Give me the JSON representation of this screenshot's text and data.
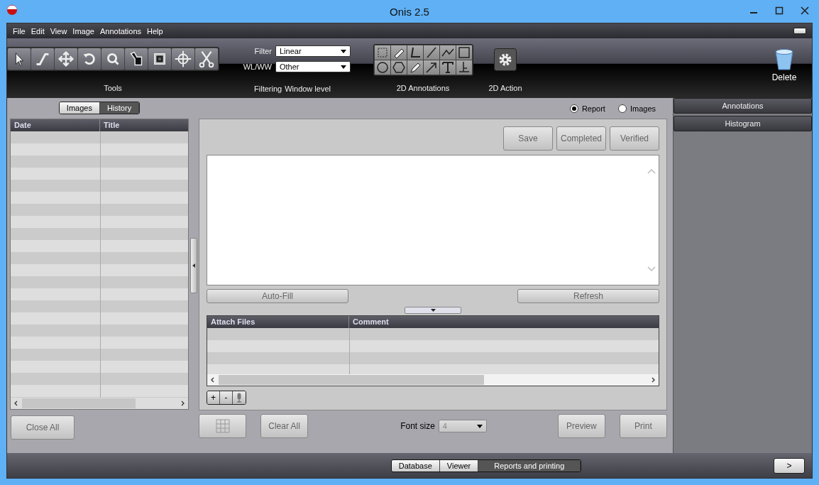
{
  "window": {
    "title": "Onis 2.5"
  },
  "menu": [
    "File",
    "Edit",
    "View",
    "Image",
    "Annotations",
    "Help"
  ],
  "toolbar": {
    "tools_label": "Tools",
    "filter": {
      "label": "Filter",
      "value": "Linear"
    },
    "wlww": {
      "label": "WL/WW",
      "value": "Other"
    },
    "filtering_label": "Filtering",
    "window_level_label": "Window level",
    "annotations_label": "2D Annotations",
    "action_label": "2D Action",
    "delete_label": "Delete"
  },
  "left_panel": {
    "tabs": [
      {
        "label": "Images",
        "selected": false
      },
      {
        "label": "History",
        "selected": true
      }
    ],
    "table": {
      "columns": [
        "Date",
        "Title"
      ]
    },
    "close_all": "Close All"
  },
  "report": {
    "view_options": [
      {
        "label": "Report",
        "selected": true
      },
      {
        "label": "Images",
        "selected": false
      }
    ],
    "actions": [
      "Save",
      "Completed",
      "Verified"
    ],
    "auto_fill": "Auto-Fill",
    "refresh": "Refresh",
    "attach_table": {
      "columns": [
        "Attach Files",
        "Comment"
      ]
    },
    "attach_buttons": [
      "+",
      "-"
    ],
    "clear_all": "Clear All",
    "font_size": {
      "label": "Font size",
      "value": "4"
    },
    "preview": "Preview",
    "print": "Print"
  },
  "right_panel": {
    "sections": [
      "Annotations",
      "Histogram"
    ]
  },
  "bottom_tabs": [
    {
      "label": "Database",
      "selected": false
    },
    {
      "label": "Viewer",
      "selected": false
    },
    {
      "label": "Reports and printing",
      "selected": true
    }
  ],
  "next_button": ">"
}
